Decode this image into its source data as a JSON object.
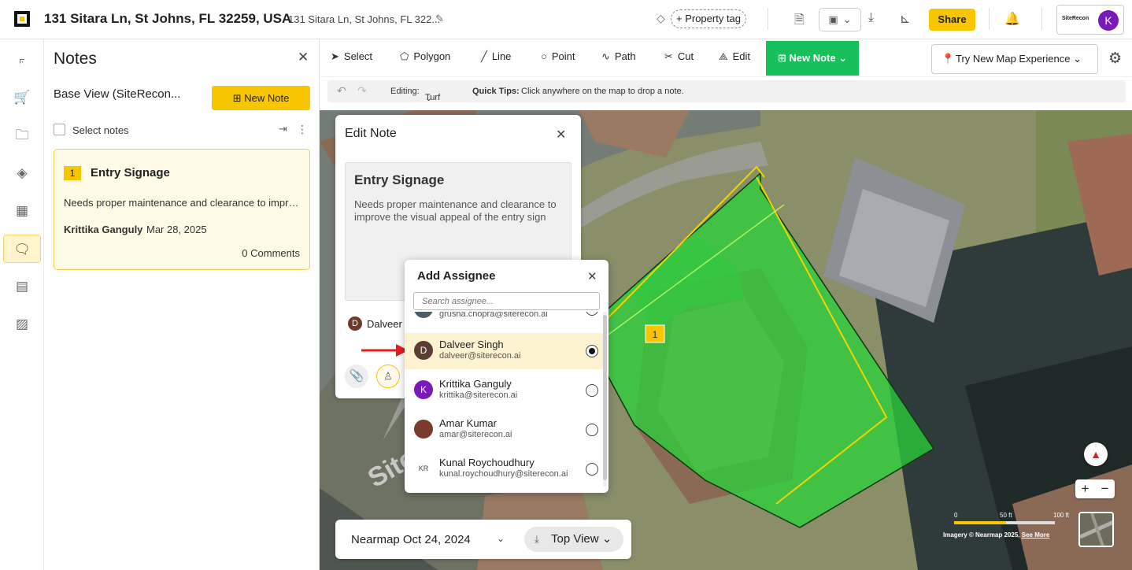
{
  "header": {
    "address_title": "131 Sitara Ln, St Johns, FL 32259, USA",
    "address_sub": "131 Sitara Ln, St Johns, FL 322...",
    "property_tag_label": "+ Property tag",
    "share_label": "Share",
    "brand": "SiteRecon",
    "user_initial": "K"
  },
  "notes_panel": {
    "title": "Notes",
    "base_view": "Base View (SiteRecon...",
    "new_note_label": "New Note",
    "select_notes_label": "Select notes",
    "cards": [
      {
        "number": "1",
        "title": "Entry Signage",
        "description": "Needs proper maintenance and clearance to improve the visual appeal of the entry sign",
        "author": "Krittika Ganguly",
        "date": "Mar 28, 2025",
        "comments": "0 Comments"
      }
    ]
  },
  "toolbar": {
    "tools": [
      "Select",
      "Polygon",
      "Line",
      "Point",
      "Path",
      "Cut",
      "Edit"
    ],
    "new_note": "New Note",
    "try_new": "Try New Map Experience"
  },
  "subbar": {
    "editing_label": "Editing:",
    "editing_value": "Turf",
    "tips_label": "Quick Tips:",
    "tips_text": "Click anywhere on the map to drop a note."
  },
  "edit_note": {
    "title": "Edit Note",
    "note_title": "Entry Signage",
    "note_desc": "Needs proper maintenance and clearance to improve the visual appeal of the entry sign",
    "assignee_initial": "D",
    "assignee_name": "Dalveer"
  },
  "add_assignee": {
    "title": "Add Assignee",
    "search_placeholder": "Search assignee...",
    "users": [
      {
        "name": "",
        "email": "grusha.chopra@siterecon.ai",
        "initial": "",
        "color": "#4d5e66",
        "selected": false
      },
      {
        "name": "Dalveer Singh",
        "email": "dalveer@siterecon.ai",
        "initial": "D",
        "color": "#5b3d33",
        "selected": true
      },
      {
        "name": "Krittika Ganguly",
        "email": "krittika@siterecon.ai",
        "initial": "K",
        "color": "#7a18b8",
        "selected": false
      },
      {
        "name": "Amar Kumar",
        "email": "amar@siterecon.ai",
        "initial": "",
        "color": "#7a3a2c",
        "selected": false
      },
      {
        "name": "Kunal Roychoudhury",
        "email": "kunal.roychoudhury@siterecon.ai",
        "initial": "KR",
        "color": "#ffffff",
        "selected": false
      }
    ]
  },
  "map": {
    "note_marker": "1",
    "imagery_date": "Nearmap Oct 24, 2024",
    "view_label": "Top View",
    "scale_labels": [
      "0",
      "50 ft",
      "100 ft"
    ],
    "credit": "Imagery © Nearmap 2025,",
    "credit_link": "See More",
    "street_text": "Site"
  }
}
